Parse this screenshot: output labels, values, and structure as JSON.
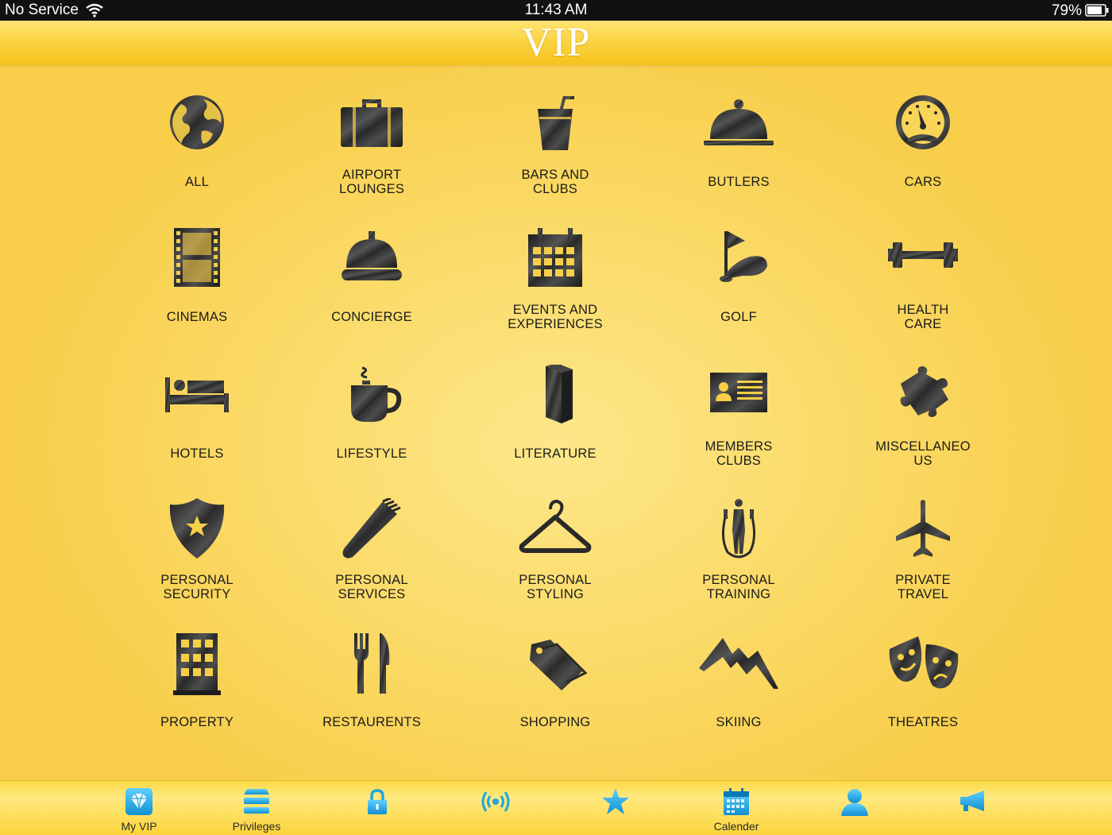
{
  "status_bar": {
    "carrier": "No Service",
    "time": "11:43 AM",
    "battery": "79%"
  },
  "header": {
    "title": "VIP"
  },
  "categories": [
    {
      "l1": "ALL",
      "l2": ""
    },
    {
      "l1": "AIRPORT",
      "l2": "LOUNGES"
    },
    {
      "l1": "BARS AND",
      "l2": "CLUBS"
    },
    {
      "l1": "BUTLERS",
      "l2": ""
    },
    {
      "l1": "CARS",
      "l2": ""
    },
    {
      "l1": "CINEMAS",
      "l2": ""
    },
    {
      "l1": "CONCIERGE",
      "l2": ""
    },
    {
      "l1": "EVENTS AND",
      "l2": "EXPERIENCES"
    },
    {
      "l1": "GOLF",
      "l2": ""
    },
    {
      "l1": "HEALTH",
      "l2": "CARE"
    },
    {
      "l1": "HOTELS",
      "l2": ""
    },
    {
      "l1": "LIFESTYLE",
      "l2": ""
    },
    {
      "l1": "LITERATURE",
      "l2": ""
    },
    {
      "l1": "MEMBERS",
      "l2": "CLUBS"
    },
    {
      "l1": "MISCELLANEO",
      "l2": "US"
    },
    {
      "l1": "PERSONAL",
      "l2": "SECURITY"
    },
    {
      "l1": "PERSONAL",
      "l2": "SERVICES"
    },
    {
      "l1": "PERSONAL",
      "l2": "STYLING"
    },
    {
      "l1": "PERSONAL",
      "l2": "TRAINING"
    },
    {
      "l1": "PRIVATE",
      "l2": "TRAVEL"
    },
    {
      "l1": "PROPERTY",
      "l2": ""
    },
    {
      "l1": "RESTAURENTS",
      "l2": ""
    },
    {
      "l1": "SHOPPING",
      "l2": ""
    },
    {
      "l1": "SKIING",
      "l2": ""
    },
    {
      "l1": "THEATRES",
      "l2": ""
    }
  ],
  "tabs": [
    {
      "label": "My VIP"
    },
    {
      "label": "Privileges"
    },
    {
      "label": ""
    },
    {
      "label": ""
    },
    {
      "label": ""
    },
    {
      "label": "Calender"
    },
    {
      "label": ""
    },
    {
      "label": ""
    }
  ],
  "colors": {
    "background": "#fbdc6c",
    "icon_dark": "#2a2a2a",
    "tab_icon": "#1ea7e0",
    "status_bar": "#111111"
  }
}
